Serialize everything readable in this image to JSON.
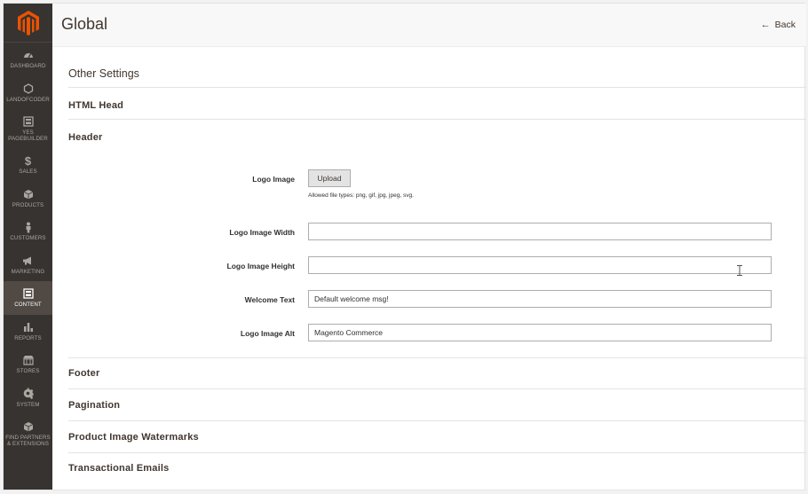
{
  "sidebar": {
    "items": [
      {
        "label": "DASHBOARD",
        "icon": "dashboard-icon"
      },
      {
        "label": "LANDOFCODER",
        "icon": "hexagon-icon"
      },
      {
        "label": "YES\nPAGEBUILDER",
        "icon": "pagebuilder-icon"
      },
      {
        "label": "SALES",
        "icon": "dollar-icon"
      },
      {
        "label": "PRODUCTS",
        "icon": "box-icon"
      },
      {
        "label": "CUSTOMERS",
        "icon": "person-icon"
      },
      {
        "label": "MARKETING",
        "icon": "megaphone-icon"
      },
      {
        "label": "CONTENT",
        "icon": "content-icon",
        "active": true
      },
      {
        "label": "REPORTS",
        "icon": "bar-chart-icon"
      },
      {
        "label": "STORES",
        "icon": "store-icon"
      },
      {
        "label": "SYSTEM",
        "icon": "gear-icon"
      },
      {
        "label": "FIND PARTNERS\n& EXTENSIONS",
        "icon": "partners-box-icon"
      }
    ]
  },
  "header": {
    "title": "Global",
    "back_label": "Back"
  },
  "main": {
    "section_title": "Other Settings",
    "fieldsets": {
      "html_head": "HTML Head",
      "header": "Header",
      "footer": "Footer",
      "pagination": "Pagination",
      "watermarks": "Product Image Watermarks",
      "emails": "Transactional Emails"
    },
    "header_fields": {
      "logo_image_label": "Logo Image",
      "upload_label": "Upload",
      "allowed_types_note": "Allowed file types: png, gif, jpg, jpeg, svg.",
      "logo_width_label": "Logo Image Width",
      "logo_width_value": "",
      "logo_height_label": "Logo Image Height",
      "logo_height_value": "",
      "welcome_label": "Welcome Text",
      "welcome_value": "Default welcome msg!",
      "logo_alt_label": "Logo Image Alt",
      "logo_alt_value": "Magento Commerce"
    }
  },
  "colors": {
    "sidebar_bg": "#373330",
    "sidebar_active": "#514943",
    "brand_orange": "#eb5202"
  }
}
